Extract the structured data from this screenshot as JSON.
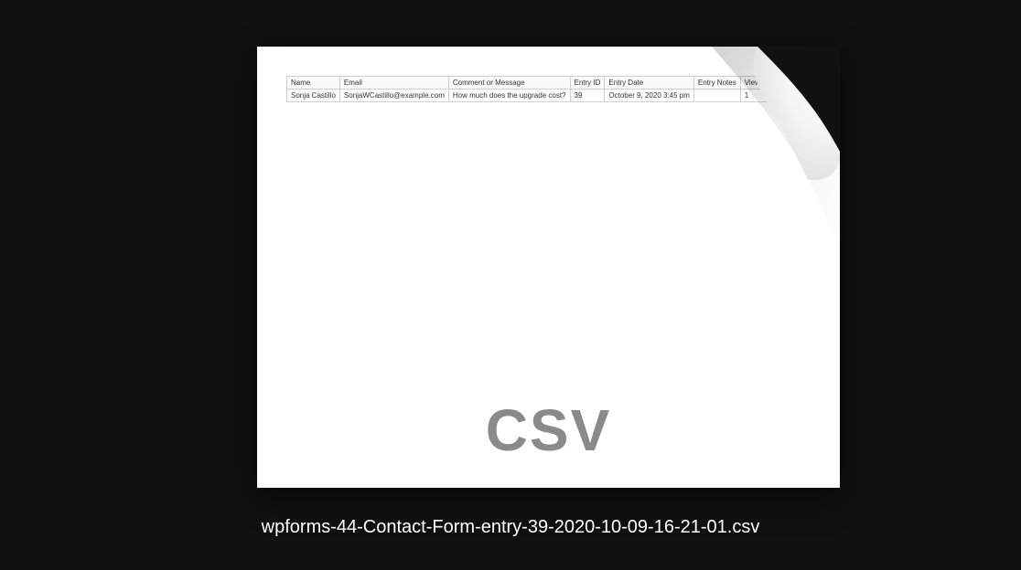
{
  "file": {
    "type_label": "CSV",
    "name": "wpforms-44-Contact-Form-entry-39-2020-10-09-16-21-01.csv"
  },
  "table": {
    "headers": [
      "Name",
      "Email",
      "Comment or Message",
      "Entry ID",
      "Entry Date",
      "Entry Notes",
      "Viewed"
    ],
    "rows": [
      {
        "name": "Sonja Castillo",
        "email": "SonjaWCastillo@example.com",
        "comment": "How much does the upgrade cost?",
        "entry_id": "39",
        "entry_date": "October 9, 2020 3:45 pm",
        "entry_notes": "",
        "viewed": "1"
      }
    ]
  }
}
